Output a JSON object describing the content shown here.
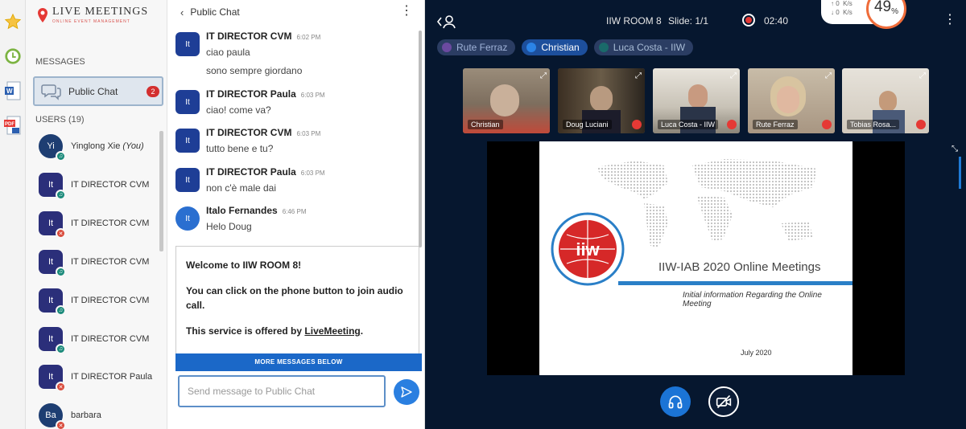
{
  "brand": {
    "title": "LIVE MEETINGS",
    "subtitle": "ONLINE EVENT MANAGEMENT"
  },
  "sidebar": {
    "messages_label": "MESSAGES",
    "public_chat": {
      "label": "Public Chat",
      "unread": "2"
    },
    "users_label": "USERS (19)",
    "users": [
      {
        "initials": "Yi",
        "name": "Yinglong Xie",
        "suffix": "(You)",
        "status": "teal"
      },
      {
        "initials": "It",
        "name": "IT DIRECTOR CVM",
        "suffix": "",
        "status": "teal"
      },
      {
        "initials": "It",
        "name": "IT DIRECTOR CVM",
        "suffix": "",
        "status": "red"
      },
      {
        "initials": "It",
        "name": "IT DIRECTOR CVM",
        "suffix": "",
        "status": "teal"
      },
      {
        "initials": "It",
        "name": "IT DIRECTOR CVM",
        "suffix": "",
        "status": "teal"
      },
      {
        "initials": "It",
        "name": "IT DIRECTOR CVM",
        "suffix": "",
        "status": "teal"
      },
      {
        "initials": "It",
        "name": "IT DIRECTOR Paula",
        "suffix": "",
        "status": "red"
      },
      {
        "initials": "Ba",
        "name": "barbara",
        "suffix": "",
        "status": "red"
      }
    ]
  },
  "chat": {
    "header": "Public Chat",
    "messages": [
      {
        "initials": "It",
        "author": "IT DIRECTOR CVM",
        "time": "6:02 PM",
        "lines": [
          "ciao paula",
          "sono sempre giordano"
        ]
      },
      {
        "initials": "It",
        "author": "IT DIRECTOR Paula",
        "time": "6:03 PM",
        "lines": [
          "ciao! come va?"
        ]
      },
      {
        "initials": "It",
        "author": "IT DIRECTOR CVM",
        "time": "6:03 PM",
        "lines": [
          "tutto bene e tu?"
        ]
      },
      {
        "initials": "It",
        "author": "IT DIRECTOR Paula",
        "time": "6:03 PM",
        "lines": [
          "non c'è male dai"
        ]
      },
      {
        "initials": "It",
        "author": "Italo Fernandes",
        "time": "6:46 PM",
        "lines": [
          "Helo Doug"
        ]
      }
    ],
    "welcome": {
      "line1_pre": "Welcome to ",
      "line1_room": "IIW ROOM 8",
      "line1_post": "!",
      "line2": "You can click on the phone button to join audio call.",
      "line3_pre": "This service is offered by ",
      "line3_link": "LiveMeeting",
      "line3_post": "."
    },
    "more_messages": "MORE MESSAGES BELOW",
    "input_placeholder": "Send message to Public Chat"
  },
  "room": {
    "name": "IIW ROOM 8",
    "slide": "Slide: 1/1",
    "timer": "02:40",
    "network": {
      "up": "0",
      "down": "0",
      "unit": "K/s"
    },
    "cpu_percent": "49",
    "cpu_unit": "%",
    "talkers": [
      {
        "name": "Rute Ferraz",
        "state": "muted"
      },
      {
        "name": "Christian",
        "state": "talking"
      },
      {
        "name": "Luca Costa - IIW",
        "state": "idle"
      }
    ],
    "videos": [
      {
        "name": "Christian",
        "muted": false,
        "bg": "#8a7a6a"
      },
      {
        "name": "Doug Luciani",
        "muted": true,
        "bg": "#3a3530"
      },
      {
        "name": "Luca Costa - IIW",
        "muted": true,
        "bg": "#cfcac0"
      },
      {
        "name": "Rute Ferraz",
        "muted": true,
        "bg": "#b8aa98"
      },
      {
        "name": "Tobias Rosa...",
        "muted": true,
        "bg": "#d8d2c8"
      }
    ],
    "slide_content": {
      "logo_text": "iiw",
      "title": "IIW-IAB 2020 Online Meetings",
      "subtitle": "Initial information Regarding the Online Meeting",
      "date": "July 2020"
    }
  },
  "colors": {
    "accent": "#1b68c8",
    "room_bg": "#06172f",
    "alert": "#d32f2f"
  }
}
